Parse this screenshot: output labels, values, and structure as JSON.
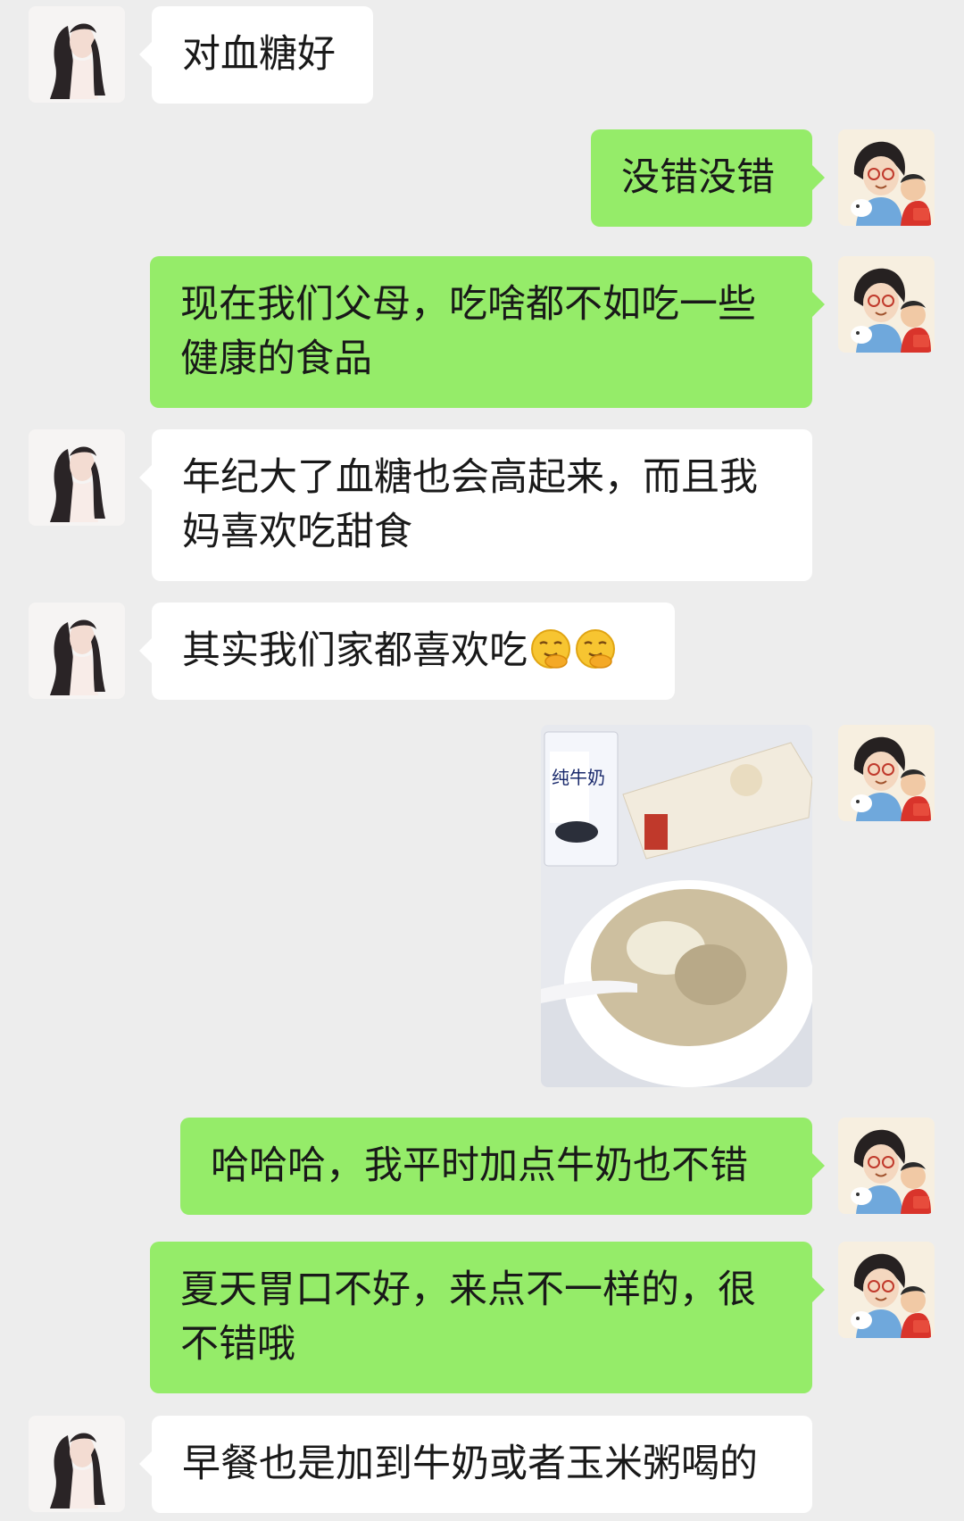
{
  "conversation": {
    "messages": [
      {
        "sender": "friend",
        "text": "对血糖好"
      },
      {
        "sender": "me",
        "text": "没错没错"
      },
      {
        "sender": "me",
        "text": "现在我们父母，吃啥都不如吃一些健康的食品"
      },
      {
        "sender": "friend",
        "text": "年纪大了血糖也会高起来，而且我妈喜欢吃甜食"
      },
      {
        "sender": "friend",
        "text": "其实我们家都喜欢吃",
        "emoji": [
          "smirk-hand-emoji",
          "smirk-hand-emoji"
        ]
      },
      {
        "sender": "me",
        "type": "image",
        "image_text": "纯牛奶"
      },
      {
        "sender": "me",
        "text": "哈哈哈，我平时加点牛奶也不错"
      },
      {
        "sender": "me",
        "text": "夏天胃口不好，来点不一样的，很不错哦"
      },
      {
        "sender": "friend",
        "text": "早餐也是加到牛奶或者玉米粥喝的"
      }
    ]
  },
  "colors": {
    "background": "#ededed",
    "incoming_bubble": "#ffffff",
    "outgoing_bubble": "#95ec69"
  }
}
